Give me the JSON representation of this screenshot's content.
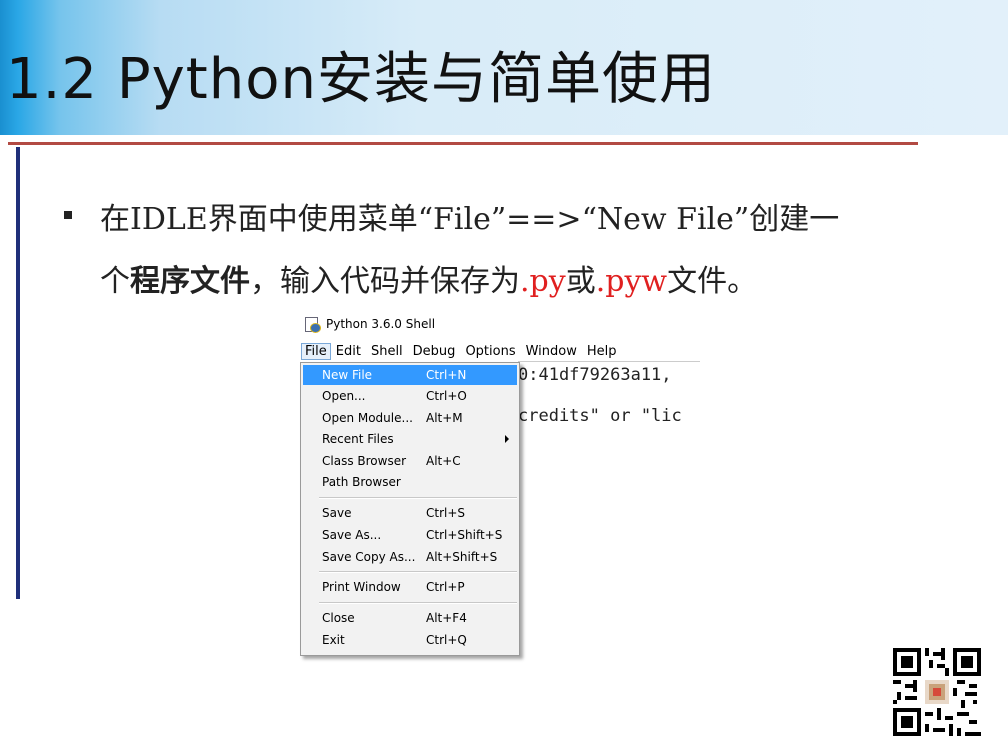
{
  "title": "1.2 Python安装与简单使用",
  "body": {
    "line1": "在IDLE界面中使用菜单“File”==>“New File”创建一",
    "line2_pre": "个",
    "line2_bold": "程序文件",
    "line2_mid": "，输入代码并保存为",
    "line2_red1": ".py",
    "line2_or": "或",
    "line2_red2": ".pyw",
    "line2_post": "文件。"
  },
  "colors": {
    "accent_red": "#e02020",
    "rule_red": "#b24a43",
    "rule_blue": "#1f2f7a",
    "menu_highlight": "#3399ff"
  },
  "idle": {
    "window_title": "Python 3.6.0 Shell",
    "menubar": [
      "File",
      "Edit",
      "Shell",
      "Debug",
      "Options",
      "Window",
      "Help"
    ],
    "editor_lines": [
      "0:41df79263a11, ",
      "credits\" or \"lic"
    ],
    "file_menu": [
      {
        "label": "New File",
        "shortcut": "Ctrl+N",
        "selected": true
      },
      {
        "label": "Open...",
        "shortcut": "Ctrl+O"
      },
      {
        "label": "Open Module...",
        "shortcut": "Alt+M"
      },
      {
        "label": "Recent Files",
        "shortcut": "",
        "submenu": true
      },
      {
        "label": "Class Browser",
        "shortcut": "Alt+C"
      },
      {
        "label": "Path Browser",
        "shortcut": ""
      },
      {
        "label": "Save",
        "shortcut": "Ctrl+S"
      },
      {
        "label": "Save As...",
        "shortcut": "Ctrl+Shift+S"
      },
      {
        "label": "Save Copy As...",
        "shortcut": "Alt+Shift+S"
      },
      {
        "label": "Print Window",
        "shortcut": "Ctrl+P"
      },
      {
        "label": "Close",
        "shortcut": "Alt+F4"
      },
      {
        "label": "Exit",
        "shortcut": "Ctrl+Q"
      }
    ]
  },
  "qr_icon": "qr-code-icon"
}
